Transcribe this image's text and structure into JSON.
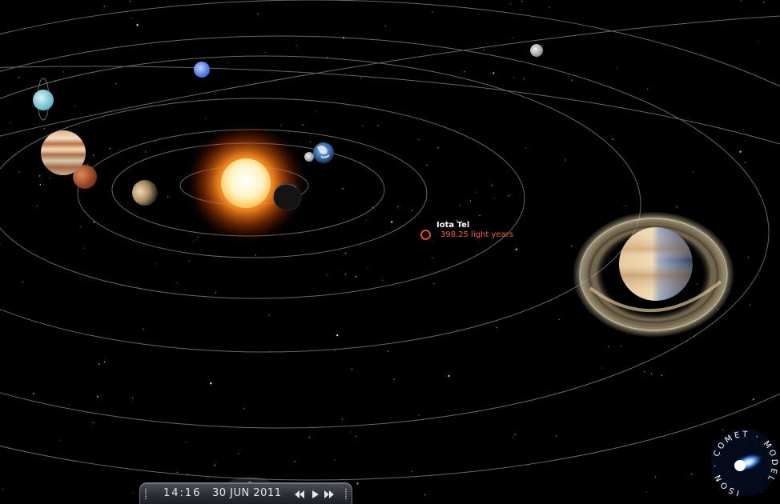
{
  "target": {
    "name": "Iota Tel",
    "distance": "398.25 light years"
  },
  "time_bar": {
    "clock": "14:16",
    "date": "30 JUN 2011",
    "controls": [
      {
        "name": "rewind",
        "icon": "rewind-icon"
      },
      {
        "name": "play",
        "icon": "play-icon"
      },
      {
        "name": "fast-forward",
        "icon": "fast-forward-icon"
      }
    ]
  },
  "badge": {
    "text": "ISON COMET MODEL"
  },
  "colors": {
    "background": "#000000",
    "orbit": "#8a8a8a",
    "sun": "#ffb347",
    "target_marker": "#d9531f",
    "distance_text": "#e8652a",
    "badge_blue": "#1f5fd6"
  },
  "bodies": [
    "sun",
    "mercury",
    "venus",
    "earth",
    "moon",
    "mars",
    "jupiter",
    "saturn",
    "uranus",
    "neptune",
    "pluto"
  ]
}
